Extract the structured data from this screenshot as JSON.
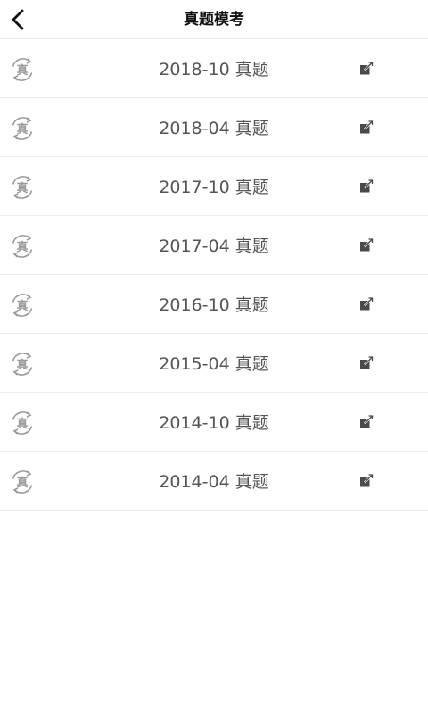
{
  "header": {
    "title": "真题模考"
  },
  "badge_glyph": "真",
  "icons": {
    "back": "chevron-left-icon",
    "badge": "real-exam-badge-icon",
    "open": "external-open-icon"
  },
  "colors": {
    "badge": "#9a9a9a",
    "open_icon": "#4a4a4a",
    "divider": "#ececec"
  },
  "items": [
    {
      "label": "2018-10 真题"
    },
    {
      "label": "2018-04 真题"
    },
    {
      "label": "2017-10 真题"
    },
    {
      "label": "2017-04 真题"
    },
    {
      "label": "2016-10 真题"
    },
    {
      "label": "2015-04 真题"
    },
    {
      "label": "2014-10 真题"
    },
    {
      "label": "2014-04 真题"
    }
  ]
}
